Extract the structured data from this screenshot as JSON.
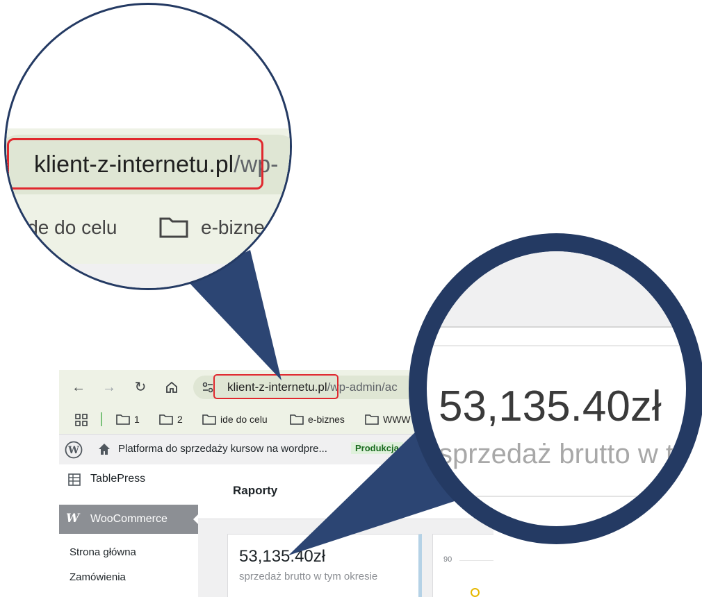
{
  "browser": {
    "url_domain": "klient-z-internetu.pl",
    "url_path": "/wp-admin/ac",
    "bookmarks": [
      {
        "label": "1"
      },
      {
        "label": "2"
      },
      {
        "label": "ide do celu"
      },
      {
        "label": "e-biznes"
      },
      {
        "label": "WWW"
      }
    ],
    "highlight_color": "#e0282e"
  },
  "admin_bar": {
    "site_name": "Platforma do sprzedaży kursow na wordpre...",
    "environment": "Produkcja"
  },
  "sidebar": {
    "tablepress": "TablePress",
    "woocommerce": "WooCommerce",
    "submenu": [
      "Strona główna",
      "Zamówienia"
    ]
  },
  "report": {
    "title": "Raporty",
    "stat_value": "53,135.40zł",
    "stat_label": "sprzedaż brutto w tym okresie",
    "chart_tick": "90"
  },
  "zoom1": {
    "url_domain": "klient-z-internetu.pl",
    "url_path": "/wp-",
    "bookmark_partial": "ide do celu",
    "bookmark_next": "e-bizne"
  },
  "zoom2": {
    "stat_value": "53,135.40zł",
    "stat_label": "sprzedaż brutto w t"
  },
  "colors": {
    "callout": "#2c4573",
    "callout_border": "#243a63"
  }
}
